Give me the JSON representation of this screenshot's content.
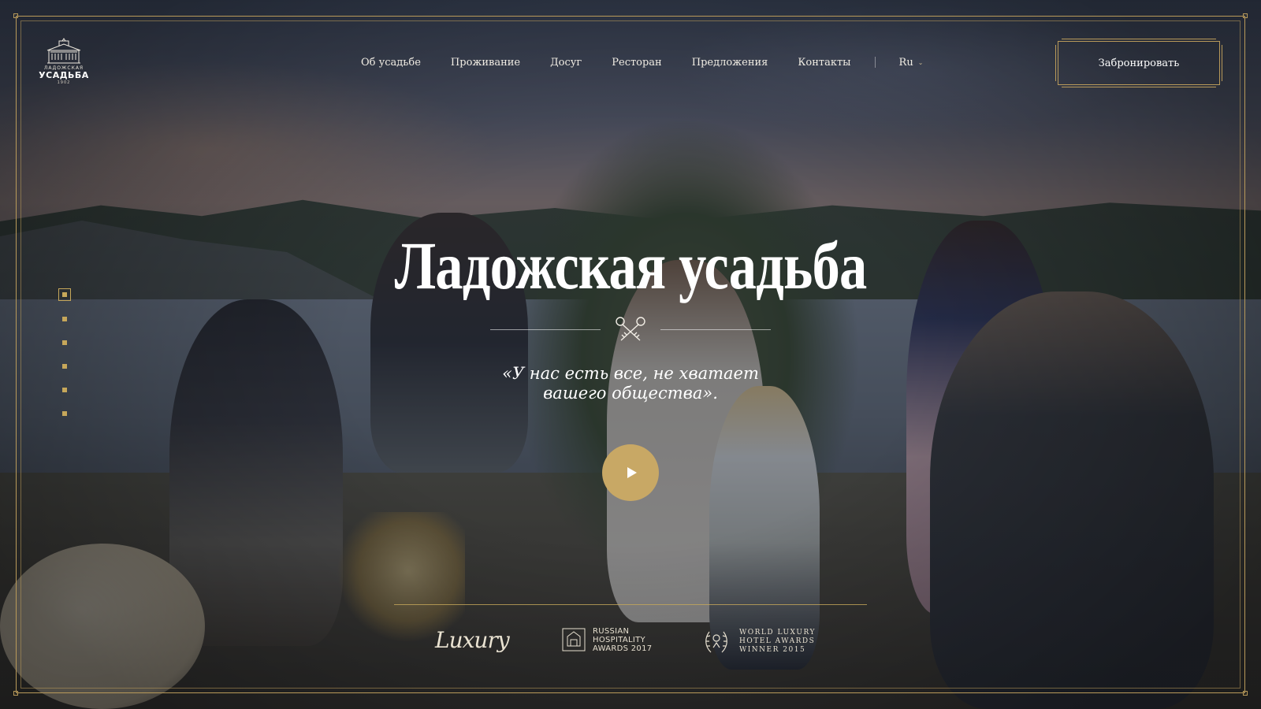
{
  "header": {
    "logo": {
      "line1": "ЛАДОЖСКАЯ",
      "line2": "УСАДЬБА",
      "line3": "1902"
    },
    "nav": [
      {
        "label": "Об усадьбе"
      },
      {
        "label": "Проживание"
      },
      {
        "label": "Досуг"
      },
      {
        "label": "Ресторан"
      },
      {
        "label": "Предложения"
      },
      {
        "label": "Контакты"
      }
    ],
    "language": "Ru",
    "book_label": "Забронировать"
  },
  "hero": {
    "title": "Ладожская усадьба",
    "quote_line1": "«У нас есть все, не хватает",
    "quote_line2": "вашего общества»."
  },
  "slider": {
    "count": 6,
    "active_index": 0
  },
  "awards": {
    "luxury": "Luxury",
    "russian_hospitality": {
      "line1": "RUSSIAN",
      "line2": "HOSPITALITY",
      "line3": "AWARDS 2017"
    },
    "world_luxury": {
      "line1": "WORLD LUXURY",
      "line2": "HOTEL AWARDS",
      "line3": "WINNER 2015"
    }
  },
  "colors": {
    "accent": "#c8a865",
    "frame": "#b99a5a",
    "overlay": "#141a28"
  },
  "icons": {
    "play": "play-icon",
    "keys": "crossed-keys-icon",
    "chevron": "chevron-down-icon"
  }
}
